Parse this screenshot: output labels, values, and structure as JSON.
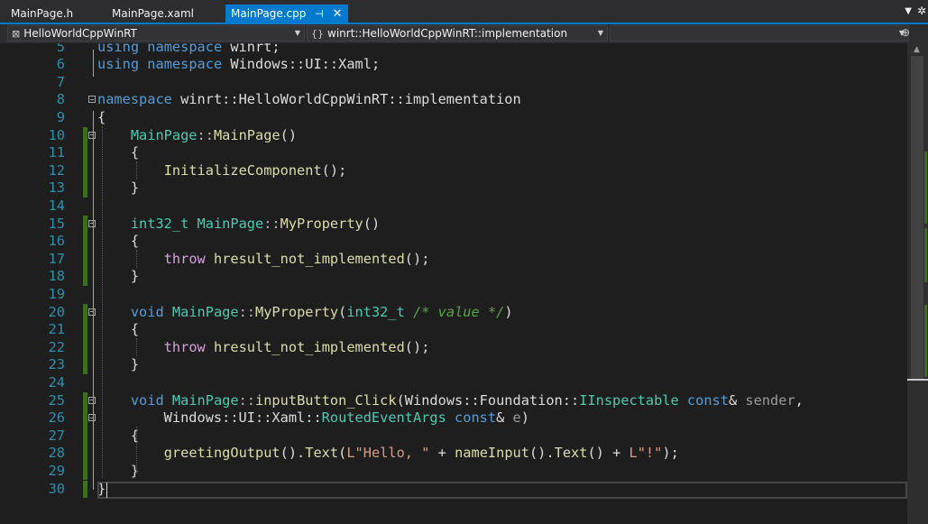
{
  "tabs": [
    {
      "label": "MainPage.h"
    },
    {
      "label": "MainPage.xaml"
    },
    {
      "label": "MainPage.cpp",
      "active": true
    }
  ],
  "nav": {
    "project": "HelloWorldCppWinRT",
    "scope": "winrt::HelloWorldCppWinRT::implementation",
    "member": ""
  },
  "lines": [
    {
      "n": "5",
      "tokens": [
        [
          "kw",
          "using"
        ],
        [
          "",
          "​ "
        ],
        [
          "kw",
          "namespace"
        ],
        [
          "",
          " winrt;"
        ]
      ]
    },
    {
      "n": "6",
      "tokens": [
        [
          "kw",
          "using"
        ],
        [
          "",
          " "
        ],
        [
          "kw",
          "namespace"
        ],
        [
          "",
          " Windows::UI::Xaml;"
        ]
      ]
    },
    {
      "n": "7",
      "tokens": []
    },
    {
      "n": "8",
      "tokens": [
        [
          "kw",
          "namespace"
        ],
        [
          "",
          " winrt::HelloWorldCppWinRT::implementation"
        ]
      ]
    },
    {
      "n": "9",
      "tokens": [
        [
          "",
          "{"
        ]
      ]
    },
    {
      "n": "10",
      "tokens": [
        [
          "",
          "    "
        ],
        [
          "ty",
          "MainPage"
        ],
        [
          "op",
          "::"
        ],
        [
          "fn",
          "MainPage"
        ],
        [
          "",
          "()"
        ]
      ]
    },
    {
      "n": "11",
      "tokens": [
        [
          "",
          "    {"
        ]
      ]
    },
    {
      "n": "12",
      "tokens": [
        [
          "",
          "        "
        ],
        [
          "fn",
          "InitializeComponent"
        ],
        [
          "",
          "();"
        ]
      ]
    },
    {
      "n": "13",
      "tokens": [
        [
          "",
          "    }"
        ]
      ]
    },
    {
      "n": "14",
      "tokens": []
    },
    {
      "n": "15",
      "tokens": [
        [
          "",
          "    "
        ],
        [
          "ty",
          "int32_t"
        ],
        [
          "",
          " "
        ],
        [
          "ty",
          "MainPage"
        ],
        [
          "op",
          "::"
        ],
        [
          "fn",
          "MyProperty"
        ],
        [
          "",
          "()"
        ]
      ]
    },
    {
      "n": "16",
      "tokens": [
        [
          "",
          "    {"
        ]
      ]
    },
    {
      "n": "17",
      "tokens": [
        [
          "",
          "        "
        ],
        [
          "ctl",
          "throw"
        ],
        [
          "",
          " "
        ],
        [
          "fn",
          "hresult_not_implemented"
        ],
        [
          "",
          "();"
        ]
      ]
    },
    {
      "n": "18",
      "tokens": [
        [
          "",
          "    }"
        ]
      ]
    },
    {
      "n": "19",
      "tokens": []
    },
    {
      "n": "20",
      "tokens": [
        [
          "",
          "    "
        ],
        [
          "kw",
          "void"
        ],
        [
          "",
          " "
        ],
        [
          "ty",
          "MainPage"
        ],
        [
          "op",
          "::"
        ],
        [
          "fn",
          "MyProperty"
        ],
        [
          "",
          "("
        ],
        [
          "ty",
          "int32_t"
        ],
        [
          "",
          " "
        ],
        [
          "cm",
          "/* value */"
        ],
        [
          "",
          ")"
        ]
      ]
    },
    {
      "n": "21",
      "tokens": [
        [
          "",
          "    {"
        ]
      ]
    },
    {
      "n": "22",
      "tokens": [
        [
          "",
          "        "
        ],
        [
          "ctl",
          "throw"
        ],
        [
          "",
          " "
        ],
        [
          "fn",
          "hresult_not_implemented"
        ],
        [
          "",
          "();"
        ]
      ]
    },
    {
      "n": "23",
      "tokens": [
        [
          "",
          "    }"
        ]
      ]
    },
    {
      "n": "24",
      "tokens": []
    },
    {
      "n": "25",
      "tokens": [
        [
          "",
          "    "
        ],
        [
          "kw",
          "void"
        ],
        [
          "",
          " "
        ],
        [
          "ty",
          "MainPage"
        ],
        [
          "op",
          "::"
        ],
        [
          "fn",
          "inputButton_Click"
        ],
        [
          "",
          "(Windows::Foundation::"
        ],
        [
          "ty",
          "IInspectable"
        ],
        [
          "",
          " "
        ],
        [
          "kw",
          "const"
        ],
        [
          "",
          "& "
        ],
        [
          "param",
          "sender"
        ],
        [
          "",
          ","
        ]
      ]
    },
    {
      "n": "26",
      "tokens": [
        [
          "",
          "        Windows::UI::Xaml::"
        ],
        [
          "ty",
          "RoutedEventArgs"
        ],
        [
          "",
          " "
        ],
        [
          "kw",
          "const"
        ],
        [
          "",
          "& "
        ],
        [
          "param",
          "e"
        ],
        [
          "",
          ")"
        ]
      ]
    },
    {
      "n": "27",
      "tokens": [
        [
          "",
          "    {"
        ]
      ]
    },
    {
      "n": "28",
      "tokens": [
        [
          "",
          "        "
        ],
        [
          "fn",
          "greetingOutput"
        ],
        [
          "",
          "()."
        ],
        [
          "fn",
          "Text"
        ],
        [
          "",
          "("
        ],
        [
          "str",
          "L\"Hello, \""
        ],
        [
          "",
          " + "
        ],
        [
          "fn",
          "nameInput"
        ],
        [
          "",
          "()."
        ],
        [
          "fn",
          "Text"
        ],
        [
          "",
          "() + "
        ],
        [
          "str",
          "L\"!\""
        ],
        [
          "",
          ");"
        ]
      ]
    },
    {
      "n": "29",
      "tokens": [
        [
          "",
          "    }"
        ]
      ]
    },
    {
      "n": "30",
      "tokens": [
        [
          "",
          "}"
        ]
      ]
    }
  ],
  "colors": {
    "accent": "#007acc",
    "changed": "#3c6e1e",
    "line_number": "#2b91af"
  },
  "icons": {
    "tab_pin": "pin-icon",
    "tab_close": "close-icon",
    "tab_list": "dropdown-icon",
    "settings": "gear-icon",
    "split": "split-icon"
  }
}
